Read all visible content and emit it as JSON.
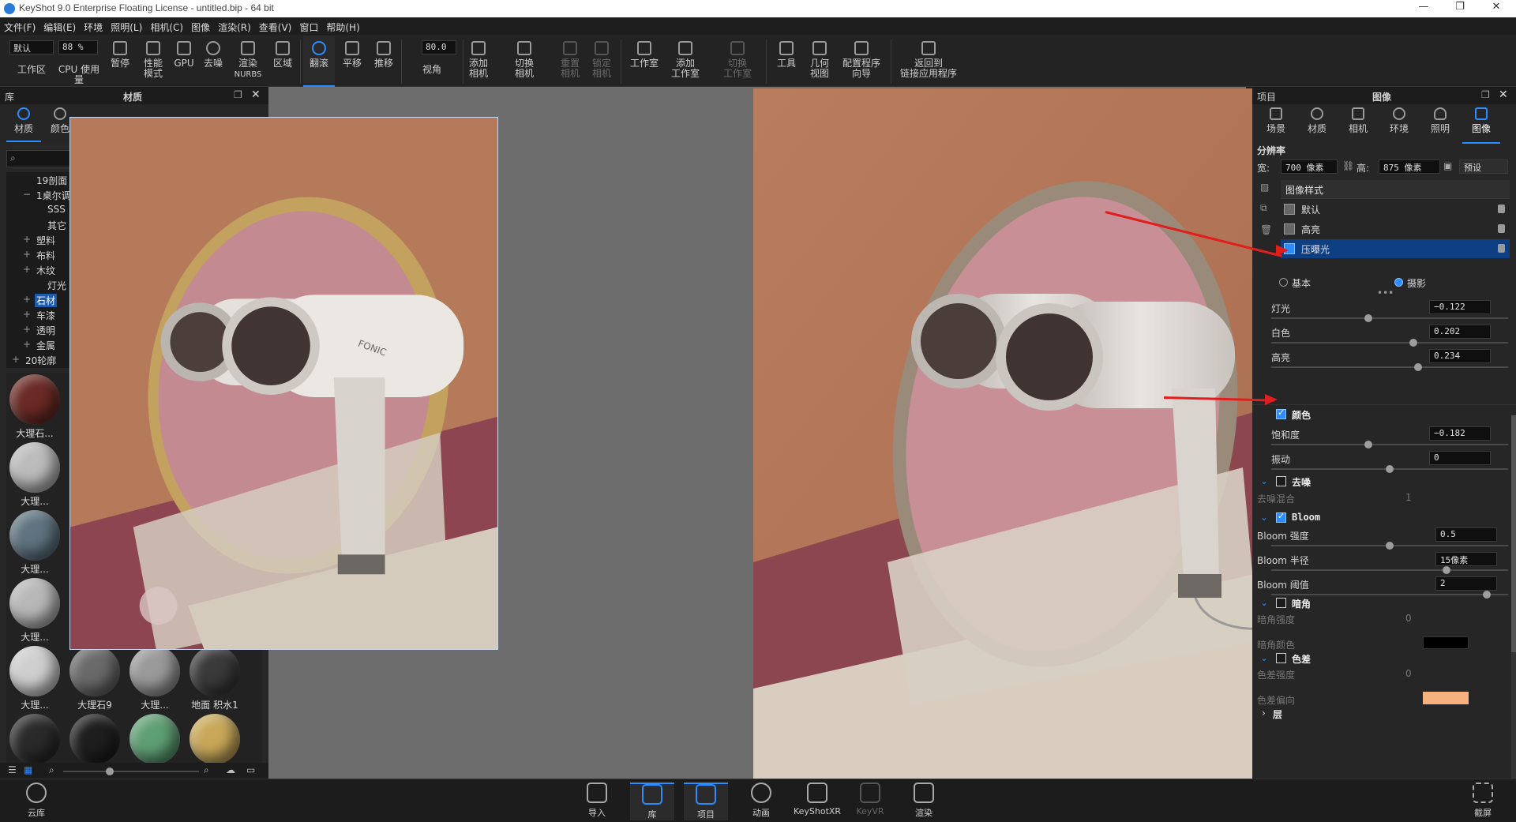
{
  "window": {
    "title": "KeyShot 9.0 Enterprise Floating License  - untitled.bip  - 64 bit"
  },
  "menu": [
    "文件(F)",
    "编辑(E)",
    "环境",
    "照明(L)",
    "相机(C)",
    "图像",
    "渲染(R)",
    "查看(V)",
    "窗口",
    "帮助(H)"
  ],
  "toolbar": {
    "workspace_value": "默认",
    "cpu_value": "88 %",
    "fov_value": "80.0",
    "items": {
      "workspace": "工作区",
      "cpu": "CPU 使用量",
      "pause": "暂停",
      "perf1": "性能",
      "perf2": "模式",
      "gpu": "GPU",
      "denoise": "去噪",
      "nurbs1": "渲染",
      "nurbs2": "NURBS",
      "region": "区域",
      "tumble": "翻滚",
      "pan": "平移",
      "dolly": "推移",
      "fov": "视角",
      "addcam1": "添加",
      "addcam2": "相机",
      "switchcam1": "切换",
      "switchcam2": "相机",
      "resetcam1": "重置",
      "resetcam2": "相机",
      "lockcam1": "锁定",
      "lockcam2": "相机",
      "studio": "工作室",
      "addstudio1": "添加",
      "addstudio2": "工作室",
      "switchstudio1": "切换",
      "switchstudio2": "工作室",
      "tools": "工具",
      "geo1": "几何",
      "geo2": "视图",
      "config1": "配置程序",
      "config2": "向导",
      "back1": "返回到",
      "back2": "链接应用程序"
    }
  },
  "library": {
    "title_left": "库",
    "title": "材质",
    "tabs": [
      "材质",
      "颜色"
    ],
    "tree": [
      {
        "pm": "",
        "label": "19剖面"
      },
      {
        "pm": "−",
        "label": "1桌尔调"
      },
      {
        "pm": "",
        "label": "SSS"
      },
      {
        "pm": "",
        "label": "其它"
      },
      {
        "pm": "+",
        "label": "塑料"
      },
      {
        "pm": "+",
        "label": "布料"
      },
      {
        "pm": "+",
        "label": "木纹"
      },
      {
        "pm": "",
        "label": "灯光"
      },
      {
        "pm": "+",
        "label": "石材"
      },
      {
        "pm": "+",
        "label": "车漆"
      },
      {
        "pm": "+",
        "label": "透明"
      },
      {
        "pm": "+",
        "label": "金属"
      },
      {
        "pm": "+",
        "label": "20轮廓"
      }
    ],
    "thumbs": [
      {
        "label": "大理石...",
        "color": "#6b2a25"
      },
      {
        "label": "大理...",
        "color": "#bcbcbc"
      },
      {
        "label": "大理...",
        "color": "#5f7480"
      },
      {
        "label": "大理...",
        "color": "#b8b8b8"
      },
      {
        "label": "大理...",
        "color": "#cfcfcf"
      },
      {
        "label": "大理石9",
        "color": "#6a6a6a"
      },
      {
        "label": "大理...",
        "color": "#9a9a9a"
      },
      {
        "label": "地面 积水1",
        "color": "#3a3a3a"
      },
      {
        "label": "",
        "color": "#2a2a2a"
      },
      {
        "label": "",
        "color": "#1e1e1e"
      },
      {
        "label": "",
        "color": "#5f9f74"
      },
      {
        "label": "",
        "color": "#c9a85a"
      }
    ]
  },
  "project": {
    "title_left": "项目",
    "title": "图像",
    "tabs": [
      "场景",
      "材质",
      "相机",
      "环境",
      "照明",
      "图像"
    ],
    "resolution_label": "分辨率",
    "width_label": "宽:",
    "width_value": "700 像素",
    "height_label": "高:",
    "height_value": "875 像素",
    "preset": "预设",
    "styles_header": "图像样式",
    "styles": [
      "默认",
      "高亮",
      "压曝光"
    ],
    "mode_basic": "基本",
    "mode_photo": "摄影",
    "sliders1": [
      {
        "label": "灯光",
        "value": "−0.122",
        "pos": 0.41
      },
      {
        "label": "白色",
        "value": "0.202",
        "pos": 0.6
      },
      {
        "label": "高亮",
        "value": "0.234",
        "pos": 0.62
      }
    ],
    "color_section": "颜色",
    "sliders2": [
      {
        "label": "饱和度",
        "value": "−0.182",
        "pos": 0.41
      },
      {
        "label": "振动",
        "value": "0",
        "pos": 0.5
      }
    ],
    "denoise_section": "去噪",
    "denoise_label": "去噪混合",
    "denoise_value": "1",
    "bloom_section": "Bloom",
    "bloom": [
      {
        "label": "Bloom 强度",
        "value": "0.5",
        "pos": 0.5
      },
      {
        "label": "Bloom 半径",
        "value": "15像素",
        "pos": 0.74
      },
      {
        "label": "Bloom 阈值",
        "value": "2",
        "pos": 0.91
      }
    ],
    "vignette_section": "暗角",
    "vignette_strength_label": "暗角强度",
    "vignette_strength_value": "0",
    "vignette_color_label": "暗角颜色",
    "ca_section": "色差",
    "ca_strength_label": "色差强度",
    "ca_strength_value": "0",
    "ca_shift_label": "色差偏向",
    "layers_section": "层"
  },
  "bottom": {
    "cloud": "云库",
    "import": "导入",
    "library": "库",
    "project": "项目",
    "animation": "动画",
    "keyshotxr": "KeyShotXR",
    "keyvr": "KeyVR",
    "render": "渲染",
    "screenshot": "截屏"
  },
  "render_text": {
    "brand": "FONIC"
  },
  "colors": {
    "accent": "#2b8dff",
    "selection": "#0e3f82",
    "vignette": "#000000",
    "chromatic": "#f5b27f",
    "annotation_arrow": "#e01e1e"
  }
}
